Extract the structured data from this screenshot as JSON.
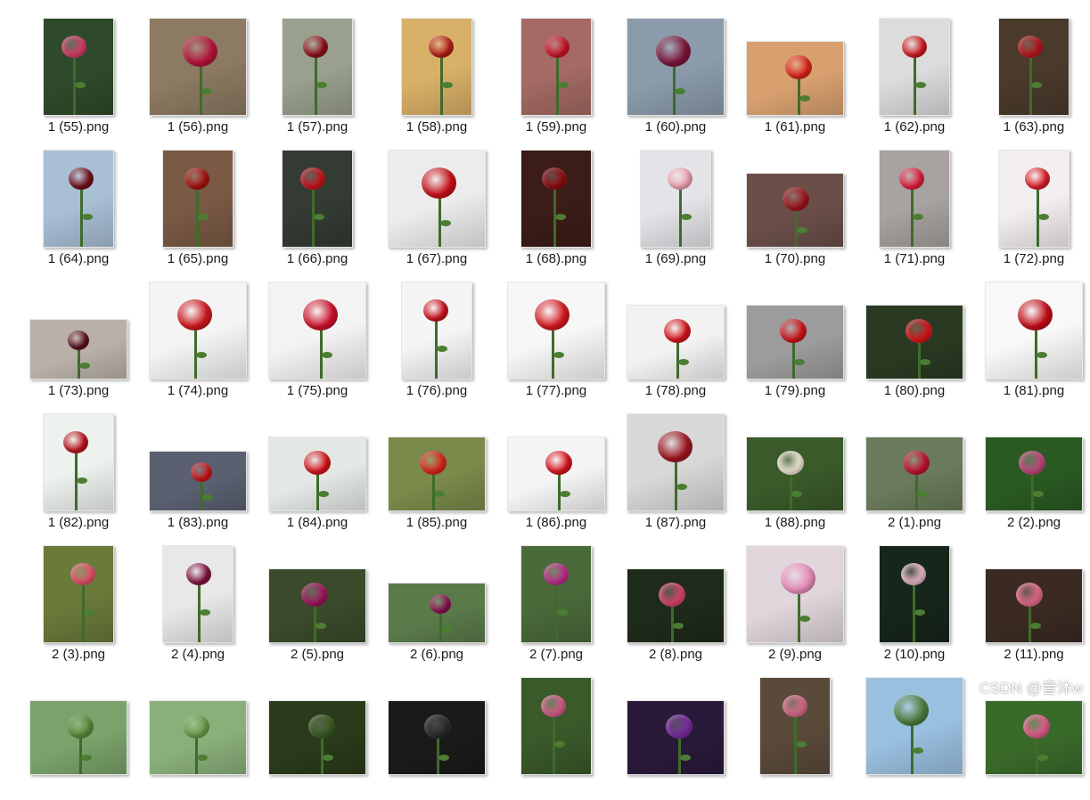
{
  "file_list": {
    "items": [
      {
        "label": "1 (55).png",
        "orientation": "portrait",
        "bg": "#2f4a2a",
        "flower": "#d63a6a"
      },
      {
        "label": "1 (56).png",
        "orientation": "square",
        "bg": "#8c7a62",
        "flower": "#b3123a"
      },
      {
        "label": "1 (57).png",
        "orientation": "portrait",
        "bg": "#9aa08e",
        "flower": "#8e0f1a"
      },
      {
        "label": "1 (58).png",
        "orientation": "portrait",
        "bg": "#d9b067",
        "flower": "#b31e18"
      },
      {
        "label": "1 (59).png",
        "orientation": "portrait",
        "bg": "#a46a63",
        "flower": "#c9142b"
      },
      {
        "label": "1 (60).png",
        "orientation": "square",
        "bg": "#8b9bac",
        "flower": "#7a1538"
      },
      {
        "label": "1 (61).png",
        "orientation": "landscape",
        "bg": "#d8a06f",
        "flower": "#d9231c"
      },
      {
        "label": "1 (62).png",
        "orientation": "portrait",
        "bg": "#dcdcdc",
        "flower": "#cc1a22"
      },
      {
        "label": "1 (63).png",
        "orientation": "portrait",
        "bg": "#4a3a2c",
        "flower": "#b8141c"
      },
      {
        "label": "1 (64).png",
        "orientation": "portrait",
        "bg": "#a9bfd6",
        "flower": "#6e0e16"
      },
      {
        "label": "1 (65).png",
        "orientation": "portrait",
        "bg": "#7a5a45",
        "flower": "#a3120e"
      },
      {
        "label": "1 (66).png",
        "orientation": "portrait",
        "bg": "#333b33",
        "flower": "#c8121c"
      },
      {
        "label": "1 (67).png",
        "orientation": "square",
        "bg": "#ececec",
        "flower": "#c40f17"
      },
      {
        "label": "1 (68).png",
        "orientation": "portrait",
        "bg": "#3c1c18",
        "flower": "#8e0c10"
      },
      {
        "label": "1 (69).png",
        "orientation": "portrait",
        "bg": "#e4e4e8",
        "flower": "#eda0ae"
      },
      {
        "label": "1 (70).png",
        "orientation": "landscape",
        "bg": "#6a4e48",
        "flower": "#9c141a"
      },
      {
        "label": "1 (71).png",
        "orientation": "portrait",
        "bg": "#a8a2a0",
        "flower": "#e01e3e"
      },
      {
        "label": "1 (72).png",
        "orientation": "portrait",
        "bg": "#f3eef0",
        "flower": "#d81e24"
      },
      {
        "label": "1 (73).png",
        "orientation": "landscape-thin",
        "bg": "#b9b1a8",
        "flower": "#5a0e22"
      },
      {
        "label": "1 (74).png",
        "orientation": "square",
        "bg": "#f4f4f4",
        "flower": "#c9171c"
      },
      {
        "label": "1 (75).png",
        "orientation": "square",
        "bg": "#f3f3f3",
        "flower": "#c8102a"
      },
      {
        "label": "1 (76).png",
        "orientation": "portrait",
        "bg": "#f5f5f5",
        "flower": "#c8101c"
      },
      {
        "label": "1 (77).png",
        "orientation": "square",
        "bg": "#f7f7f7",
        "flower": "#d01820"
      },
      {
        "label": "1 (78).png",
        "orientation": "landscape",
        "bg": "#f2f2f2",
        "flower": "#d2141c"
      },
      {
        "label": "1 (79).png",
        "orientation": "landscape",
        "bg": "#9c9c9c",
        "flower": "#cc1218"
      },
      {
        "label": "1 (80).png",
        "orientation": "landscape",
        "bg": "#2a3a22",
        "flower": "#d8141a"
      },
      {
        "label": "1 (81).png",
        "orientation": "square",
        "bg": "#f8f8f8",
        "flower": "#be0c16"
      },
      {
        "label": "1 (82).png",
        "orientation": "portrait",
        "bg": "#eef2ee",
        "flower": "#b8141c"
      },
      {
        "label": "1 (83).png",
        "orientation": "landscape-thin",
        "bg": "#5a6070",
        "flower": "#cc1418"
      },
      {
        "label": "1 (84).png",
        "orientation": "landscape",
        "bg": "#e4e8e4",
        "flower": "#d2141c"
      },
      {
        "label": "1 (85).png",
        "orientation": "landscape",
        "bg": "#7a8a4a",
        "flower": "#d8241a"
      },
      {
        "label": "1 (86).png",
        "orientation": "landscape",
        "bg": "#f4f4f4",
        "flower": "#d4121c"
      },
      {
        "label": "1 (87).png",
        "orientation": "square",
        "bg": "#d8d8d8",
        "flower": "#9a1420"
      },
      {
        "label": "1 (88).png",
        "orientation": "landscape",
        "bg": "#3a5a2a",
        "flower": "#f2e6d8"
      },
      {
        "label": "2 (1).png",
        "orientation": "landscape",
        "bg": "#6a7a5a",
        "flower": "#c0102c"
      },
      {
        "label": "2 (2).png",
        "orientation": "landscape",
        "bg": "#2a5a22",
        "flower": "#c0457e"
      },
      {
        "label": "2 (3).png",
        "orientation": "portrait",
        "bg": "#6a7a3a",
        "flower": "#e4506a"
      },
      {
        "label": "2 (4).png",
        "orientation": "portrait",
        "bg": "#e8e8e8",
        "flower": "#7e1240"
      },
      {
        "label": "2 (5).png",
        "orientation": "landscape",
        "bg": "#3a4a2a",
        "flower": "#a0145e"
      },
      {
        "label": "2 (6).png",
        "orientation": "landscape-thin",
        "bg": "#5a7a4a",
        "flower": "#8a1050"
      },
      {
        "label": "2 (7).png",
        "orientation": "portrait",
        "bg": "#4a6a3a",
        "flower": "#c02a8a"
      },
      {
        "label": "2 (8).png",
        "orientation": "landscape",
        "bg": "#1e2a1a",
        "flower": "#d8426e"
      },
      {
        "label": "2 (9).png",
        "orientation": "square",
        "bg": "#e0d6dc",
        "flower": "#e48ab8"
      },
      {
        "label": "2 (10).png",
        "orientation": "portrait",
        "bg": "#16261a",
        "flower": "#e8b8c8"
      },
      {
        "label": "2 (11).png",
        "orientation": "landscape",
        "bg": "#3a2a22",
        "flower": "#e26a8a"
      },
      {
        "label": "",
        "orientation": "landscape",
        "bg": "#7aa26a",
        "flower": "#5a8a3a"
      },
      {
        "label": "",
        "orientation": "landscape",
        "bg": "#8ab07a",
        "flower": "#6a9a4a"
      },
      {
        "label": "",
        "orientation": "landscape",
        "bg": "#2a3a1a",
        "flower": "#3a5a22"
      },
      {
        "label": "",
        "orientation": "landscape",
        "bg": "#1a1a1a",
        "flower": "#2a2a2a"
      },
      {
        "label": "",
        "orientation": "portrait",
        "bg": "#3a5a2a",
        "flower": "#d85a8a"
      },
      {
        "label": "",
        "orientation": "landscape",
        "bg": "#2a1a3a",
        "flower": "#7a2aa0"
      },
      {
        "label": "",
        "orientation": "portrait",
        "bg": "#5a4a3a",
        "flower": "#d86a8a"
      },
      {
        "label": "",
        "orientation": "square",
        "bg": "#9ac0e0",
        "flower": "#4a7a3a"
      },
      {
        "label": "",
        "orientation": "landscape",
        "bg": "#3a6a2a",
        "flower": "#e25a8a"
      }
    ]
  },
  "watermark": {
    "text": "CSDN @音沐w"
  }
}
